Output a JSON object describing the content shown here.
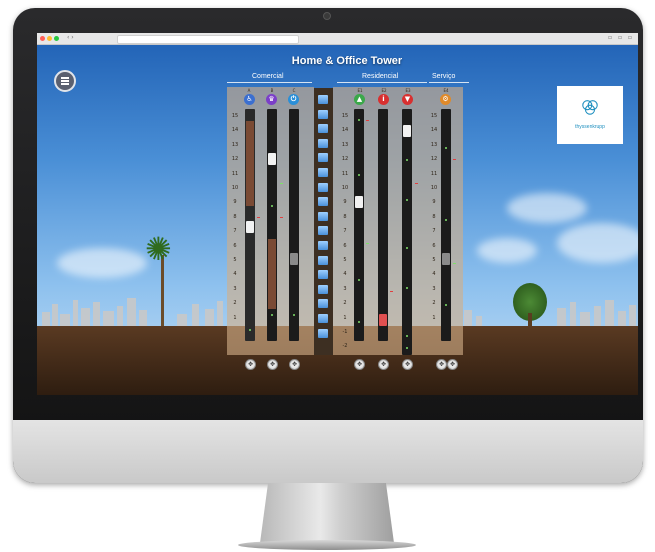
{
  "app": {
    "title": "Home & Office Tower",
    "sections": {
      "commercial": "Comercial",
      "residential": "Residencial",
      "service": "Serviço"
    },
    "logo_text": "thyssenkrupp"
  },
  "commercial_columns": [
    {
      "letter": "A",
      "icon": "wheelchair-icon",
      "icon_color": "#3b6fd0"
    },
    {
      "letter": "B",
      "icon": "crown-icon",
      "icon_color": "#7b3fc8"
    },
    {
      "letter": "C",
      "icon": "power-icon",
      "icon_color": "#2a8fd8"
    }
  ],
  "residential_columns": [
    {
      "letter": "E1",
      "icon": "up-arrow-icon",
      "icon_color": "#3aa84a"
    },
    {
      "letter": "E2",
      "icon": "info-icon",
      "icon_color": "#d83030"
    },
    {
      "letter": "E3",
      "icon": "down-arrow-icon",
      "icon_color": "#d83030"
    }
  ],
  "service_columns": [
    {
      "letter": "E4",
      "icon": "tools-icon",
      "icon_color": "#e08a2a"
    }
  ],
  "floors_commercial": [
    "15",
    "14",
    "13",
    "12",
    "11",
    "10",
    "9",
    "8",
    "7",
    "6",
    "5",
    "4",
    "3",
    "2",
    "1"
  ],
  "floors_residential": [
    "15",
    "14",
    "13",
    "12",
    "11",
    "10",
    "9",
    "8",
    "7",
    "6",
    "5",
    "4",
    "3",
    "2",
    "1",
    "-1",
    "-2"
  ],
  "floors_service": [
    "15",
    "14",
    "13",
    "12",
    "11",
    "10",
    "9",
    "8",
    "7",
    "6",
    "5",
    "4",
    "3",
    "2",
    "1"
  ],
  "colors": {
    "panel": "#d2af87",
    "shaft": "#1b1b1b",
    "car_white": "#f2f2f2",
    "car_red": "#e05050",
    "car_grey": "#8a8a8a",
    "shaft_brown": "#7a4a34",
    "indicator_green": "#7fe06a",
    "indicator_red": "#e04040"
  },
  "icons": {
    "menu": "hamburger-menu-icon",
    "control": "move-arrows-icon"
  }
}
